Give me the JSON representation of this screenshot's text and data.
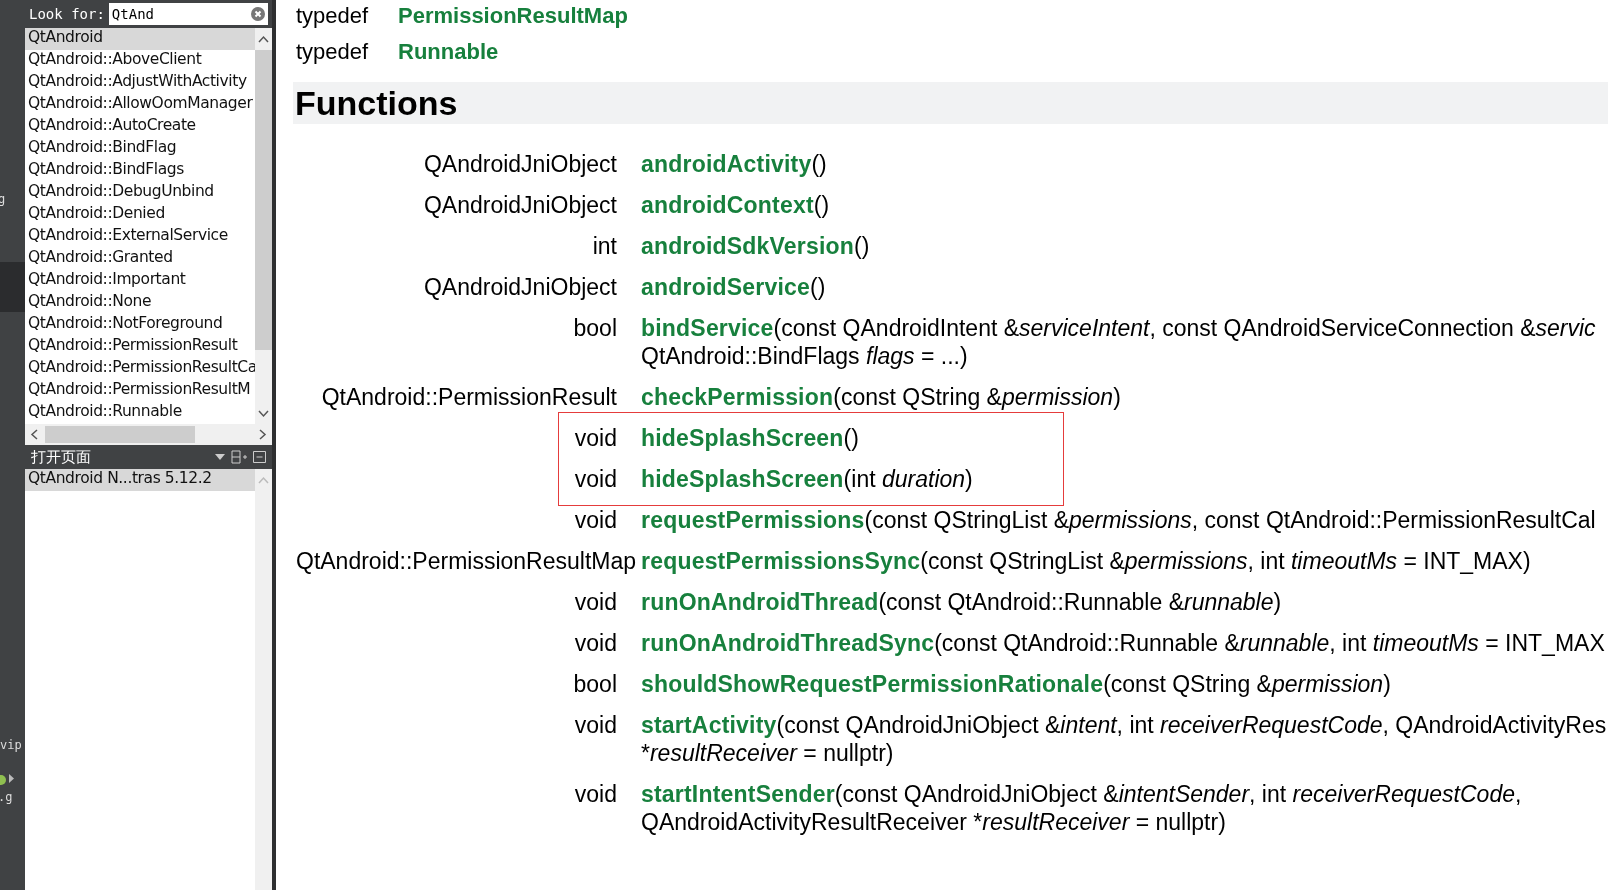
{
  "mode_strip": {
    "fragments": [
      {
        "text": "g",
        "kind": "label"
      },
      {
        "text": "vip",
        "kind": "label"
      },
      {
        "text": ".g",
        "kind": "label"
      }
    ],
    "selected_slot": true
  },
  "index": {
    "search": {
      "label": "Look for:",
      "value": "QtAnd"
    },
    "items": [
      {
        "label": "QtAndroid",
        "selected": true
      },
      {
        "label": "QtAndroid::AboveClient",
        "selected": false
      },
      {
        "label": "QtAndroid::AdjustWithActivity",
        "selected": false
      },
      {
        "label": "QtAndroid::AllowOomManager",
        "selected": false
      },
      {
        "label": "QtAndroid::AutoCreate",
        "selected": false
      },
      {
        "label": "QtAndroid::BindFlag",
        "selected": false
      },
      {
        "label": "QtAndroid::BindFlags",
        "selected": false
      },
      {
        "label": "QtAndroid::DebugUnbind",
        "selected": false
      },
      {
        "label": "QtAndroid::Denied",
        "selected": false
      },
      {
        "label": "QtAndroid::ExternalService",
        "selected": false
      },
      {
        "label": "QtAndroid::Granted",
        "selected": false
      },
      {
        "label": "QtAndroid::Important",
        "selected": false
      },
      {
        "label": "QtAndroid::None",
        "selected": false
      },
      {
        "label": "QtAndroid::NotForeground",
        "selected": false
      },
      {
        "label": "QtAndroid::PermissionResult",
        "selected": false
      },
      {
        "label": "QtAndroid::PermissionResultCa",
        "selected": false
      },
      {
        "label": "QtAndroid::PermissionResultM",
        "selected": false
      },
      {
        "label": "QtAndroid::Runnable",
        "selected": false
      }
    ]
  },
  "open_pages": {
    "title": "打开页面",
    "items": [
      {
        "label": "QtAndroid N...tras 5.12.2",
        "selected": true
      }
    ]
  },
  "doc": {
    "typedefs": [
      {
        "type": "typedef",
        "name": "PermissionResultMap"
      },
      {
        "type": "typedef",
        "name": "Runnable"
      }
    ],
    "section_title": "Functions",
    "functions": [
      {
        "returns": "QAndroidJniObject",
        "name": "androidActivity",
        "params": [
          [
            {
              "text": "()",
              "italic": false
            }
          ]
        ],
        "highlighted": false
      },
      {
        "returns": "QAndroidJniObject",
        "name": "androidContext",
        "params": [
          [
            {
              "text": "()",
              "italic": false
            }
          ]
        ],
        "highlighted": false
      },
      {
        "returns": "int",
        "name": "androidSdkVersion",
        "params": [
          [
            {
              "text": "()",
              "italic": false
            }
          ]
        ],
        "highlighted": false
      },
      {
        "returns": "QAndroidJniObject",
        "name": "androidService",
        "params": [
          [
            {
              "text": "()",
              "italic": false
            }
          ]
        ],
        "highlighted": false
      },
      {
        "returns": "bool",
        "name": "bindService",
        "params": [
          [
            {
              "text": "(const QAndroidIntent &",
              "italic": false
            },
            {
              "text": "serviceIntent",
              "italic": true
            },
            {
              "text": ", const QAndroidServiceConnection &",
              "italic": false
            },
            {
              "text": "servic",
              "italic": true
            }
          ],
          [
            {
              "text": "QtAndroid::BindFlags ",
              "italic": false
            },
            {
              "text": "flags",
              "italic": true
            },
            {
              "text": " = ...)",
              "italic": false
            }
          ]
        ],
        "highlighted": false
      },
      {
        "returns": "QtAndroid::PermissionResult",
        "name": "checkPermission",
        "params": [
          [
            {
              "text": "(const QString &",
              "italic": false
            },
            {
              "text": "permission",
              "italic": true
            },
            {
              "text": ")",
              "italic": false
            }
          ]
        ],
        "highlighted": false
      },
      {
        "returns": "void",
        "name": "hideSplashScreen",
        "params": [
          [
            {
              "text": "()",
              "italic": false
            }
          ]
        ],
        "highlighted": true
      },
      {
        "returns": "void",
        "name": "hideSplashScreen",
        "params": [
          [
            {
              "text": "(int ",
              "italic": false
            },
            {
              "text": "duration",
              "italic": true
            },
            {
              "text": ")",
              "italic": false
            }
          ]
        ],
        "highlighted": true
      },
      {
        "returns": "void",
        "name": "requestPermissions",
        "params": [
          [
            {
              "text": "(const QStringList &",
              "italic": false
            },
            {
              "text": "permissions",
              "italic": true
            },
            {
              "text": ", const QtAndroid::PermissionResultCal",
              "italic": false
            }
          ]
        ],
        "highlighted": false
      },
      {
        "returns": "QtAndroid::PermissionResultMap",
        "name": "requestPermissionsSync",
        "params": [
          [
            {
              "text": "(const QStringList &",
              "italic": false
            },
            {
              "text": "permissions",
              "italic": true
            },
            {
              "text": ", int ",
              "italic": false
            },
            {
              "text": "timeoutMs",
              "italic": true
            },
            {
              "text": " = INT_MAX)",
              "italic": false
            }
          ]
        ],
        "highlighted": false
      },
      {
        "returns": "void",
        "name": "runOnAndroidThread",
        "params": [
          [
            {
              "text": "(const QtAndroid::Runnable &",
              "italic": false
            },
            {
              "text": "runnable",
              "italic": true
            },
            {
              "text": ")",
              "italic": false
            }
          ]
        ],
        "highlighted": false
      },
      {
        "returns": "void",
        "name": "runOnAndroidThreadSync",
        "params": [
          [
            {
              "text": "(const QtAndroid::Runnable &",
              "italic": false
            },
            {
              "text": "runnable",
              "italic": true
            },
            {
              "text": ", int ",
              "italic": false
            },
            {
              "text": "timeoutMs",
              "italic": true
            },
            {
              "text": " = INT_MAX",
              "italic": false
            }
          ]
        ],
        "highlighted": false
      },
      {
        "returns": "bool",
        "name": "shouldShowRequestPermissionRationale",
        "params": [
          [
            {
              "text": "(const QString &",
              "italic": false
            },
            {
              "text": "permission",
              "italic": true
            },
            {
              "text": ")",
              "italic": false
            }
          ]
        ],
        "highlighted": false
      },
      {
        "returns": "void",
        "name": "startActivity",
        "params": [
          [
            {
              "text": "(const QAndroidJniObject &",
              "italic": false
            },
            {
              "text": "intent",
              "italic": true
            },
            {
              "text": ", int ",
              "italic": false
            },
            {
              "text": "receiverRequestCode",
              "italic": true
            },
            {
              "text": ", QAndroidActivityRes",
              "italic": false
            }
          ],
          [
            {
              "text": "*",
              "italic": false
            },
            {
              "text": "resultReceiver",
              "italic": true
            },
            {
              "text": " = nullptr)",
              "italic": false
            }
          ]
        ],
        "highlighted": false
      },
      {
        "returns": "void",
        "name": "startIntentSender",
        "params": [
          [
            {
              "text": "(const QAndroidJniObject &",
              "italic": false
            },
            {
              "text": "intentSender",
              "italic": true
            },
            {
              "text": ", int ",
              "italic": false
            },
            {
              "text": "receiverRequestCode",
              "italic": true
            },
            {
              "text": ",",
              "italic": false
            }
          ],
          [
            {
              "text": "QAndroidActivityResultReceiver *",
              "italic": false
            },
            {
              "text": "resultReceiver",
              "italic": true
            },
            {
              "text": " = nullptr)",
              "italic": false
            }
          ]
        ],
        "highlighted": false
      }
    ]
  }
}
